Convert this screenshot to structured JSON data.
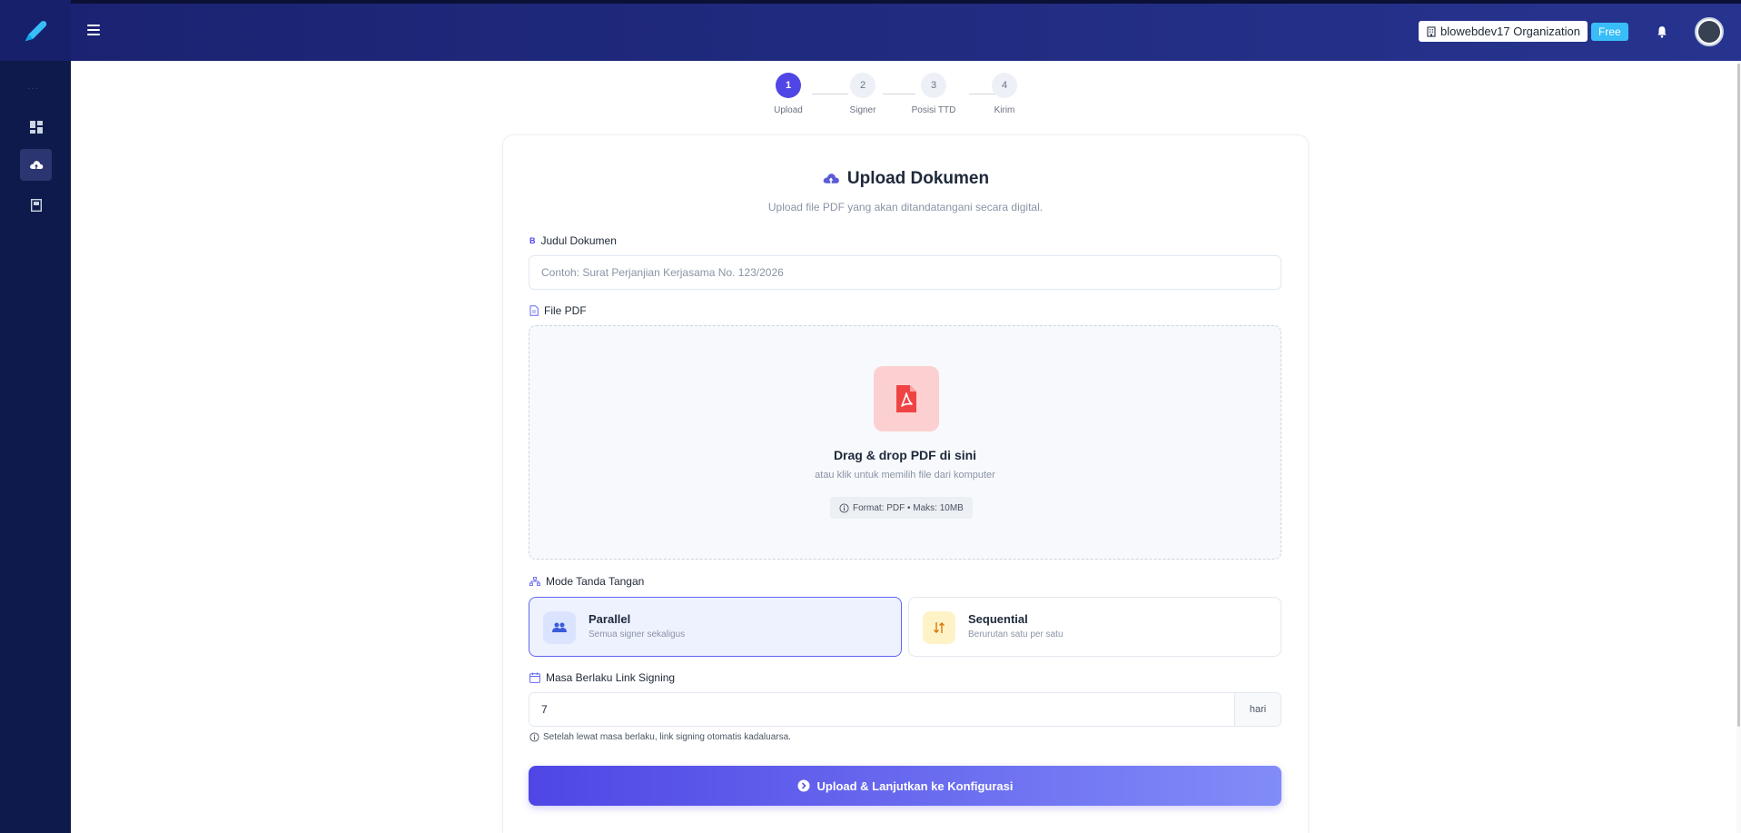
{
  "header": {
    "organization": "blowebdev17 Organization",
    "plan_badge": "Free"
  },
  "stepper": {
    "steps": [
      {
        "number": "1",
        "label": "Upload"
      },
      {
        "number": "2",
        "label": "Signer"
      },
      {
        "number": "3",
        "label": "Posisi TTD"
      },
      {
        "number": "4",
        "label": "Kirim"
      }
    ],
    "active_step": 1
  },
  "form": {
    "title": "Upload Dokumen",
    "subtitle": "Upload file PDF yang akan ditandatangani secara digital.",
    "document_title": {
      "badge": "B",
      "label": "Judul Dokumen",
      "placeholder": "Contoh: Surat Perjanjian Kerjasama No. 123/2026",
      "value": ""
    },
    "file": {
      "label": "File PDF",
      "dropzone_title": "Drag & drop PDF di sini",
      "dropzone_subtitle": "atau klik untuk memilih file dari komputer",
      "format_hint": "Format: PDF • Maks: 10MB"
    },
    "mode": {
      "label": "Mode Tanda Tangan",
      "options": [
        {
          "title": "Parallel",
          "description": "Semua signer sekaligus",
          "selected": true
        },
        {
          "title": "Sequential",
          "description": "Berurutan satu per satu",
          "selected": false
        }
      ]
    },
    "expiry": {
      "label": "Masa Berlaku Link Signing",
      "value": "7",
      "unit": "hari",
      "helper": "Setelah lewat masa berlaku, link signing otomatis kadaluarsa."
    },
    "submit_label": "Upload & Lanjutkan ke Konfigurasi"
  },
  "colors": {
    "topbar": "#1f2a80",
    "sidebar": "#0f1a4c",
    "accent": "#4f46e5",
    "plan_badge": "#38bdf8",
    "pdf_tile": "#fcd0d0",
    "pdf_icon": "#ef4444"
  },
  "icons": {
    "brand": "pen-icon",
    "menu": "hamburger-icon",
    "org": "building-icon",
    "notifications": "bell-icon",
    "sidebar": [
      "dashboard-icon",
      "cloud-upload-icon",
      "document-icon"
    ]
  }
}
